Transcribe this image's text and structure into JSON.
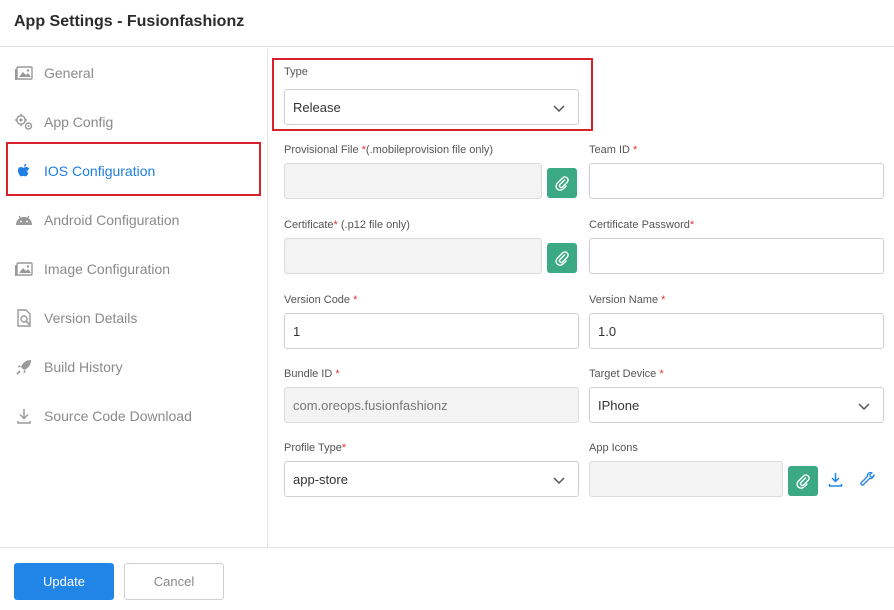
{
  "header": {
    "title": "App Settings - Fusionfashionz"
  },
  "sidebar": {
    "items": [
      {
        "label": "General",
        "icon": "image-icon"
      },
      {
        "label": "App Config",
        "icon": "gears-icon"
      },
      {
        "label": "IOS Configuration",
        "icon": "apple-icon",
        "active": true
      },
      {
        "label": "Android Configuration",
        "icon": "android-icon"
      },
      {
        "label": "Image Configuration",
        "icon": "image-icon"
      },
      {
        "label": "Version Details",
        "icon": "document-search-icon"
      },
      {
        "label": "Build History",
        "icon": "rocket-icon"
      },
      {
        "label": "Source Code Download",
        "icon": "download-icon"
      }
    ]
  },
  "form": {
    "type": {
      "label": "Type",
      "value": "Release"
    },
    "provisional_file": {
      "label": "Provisional File ",
      "required": "*",
      "note": "(.mobileprovision file only)",
      "value": ""
    },
    "team_id": {
      "label": "Team ID ",
      "required": "*",
      "value": ""
    },
    "certificate": {
      "label": "Certificate",
      "required": "*",
      "note": " (.p12 file only)",
      "value": ""
    },
    "certificate_password": {
      "label": "Certificate Password",
      "required": "*",
      "value": ""
    },
    "version_code": {
      "label": "Version Code ",
      "required": "*",
      "value": "1"
    },
    "version_name": {
      "label": "Version Name ",
      "required": "*",
      "value": "1.0"
    },
    "bundle_id": {
      "label": "Bundle ID ",
      "required": "*",
      "value": "com.oreops.fusionfashionz"
    },
    "target_device": {
      "label": "Target Device ",
      "required": "*",
      "value": "IPhone"
    },
    "profile_type": {
      "label": "Profile Type",
      "required": "*",
      "value": "app-store"
    },
    "app_icons": {
      "label": "App Icons",
      "value": ""
    }
  },
  "footer": {
    "update_label": "Update",
    "cancel_label": "Cancel"
  },
  "colors": {
    "accent": "#2185e8",
    "active_nav": "#1e7ee3",
    "attach_button": "#3aa984",
    "required": "#e03434",
    "highlight_box": "#d9212b"
  }
}
